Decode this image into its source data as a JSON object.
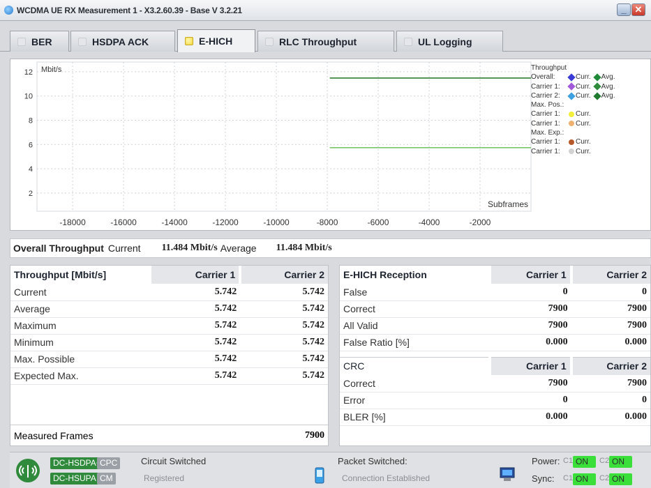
{
  "window": {
    "title": "WCDMA UE RX Measurement 1 - X3.2.60.39 - Base V 3.2.21",
    "minimize_glyph": "_",
    "close_glyph": "✕"
  },
  "tabs": [
    {
      "label": "BER",
      "active": false
    },
    {
      "label": "HSDPA ACK",
      "active": false
    },
    {
      "label": "E-HICH",
      "active": true
    },
    {
      "label": "RLC Throughput",
      "active": false
    },
    {
      "label": "UL Logging",
      "active": false
    }
  ],
  "chart": {
    "unit_label": "Mbit/s",
    "x_axis_label": "Subframes",
    "x_tick_labels": [
      "-18000",
      "-16000",
      "-14000",
      "-12000",
      "-10000",
      "-8000",
      "-6000",
      "-4000",
      "-2000"
    ],
    "y_tick_labels": [
      "12",
      "10",
      "8",
      "6",
      "4",
      "2"
    ],
    "legend": {
      "title": "Throughput",
      "rows": [
        {
          "label": "Overall:",
          "items": [
            {
              "text": "Curr.",
              "color": "#3a3ad6",
              "shape": "diamond"
            },
            {
              "text": "Avg.",
              "color": "#1f8a3a",
              "shape": "diamond"
            }
          ]
        },
        {
          "label": "Carrier 1:",
          "items": [
            {
              "text": "Curr.",
              "color": "#a259d9",
              "shape": "diamond"
            },
            {
              "text": "Avg.",
              "color": "#2e8b3a",
              "shape": "diamond"
            }
          ]
        },
        {
          "label": "Carrier 2:",
          "items": [
            {
              "text": "Curr.",
              "color": "#3da0e0",
              "shape": "diamond"
            },
            {
              "text": "Avg.",
              "color": "#1f7a2f",
              "shape": "diamond"
            }
          ]
        },
        {
          "label": "Max. Pos.:",
          "items": []
        },
        {
          "label": "Carrier 1:",
          "items": [
            {
              "text": "Curr.",
              "color": "#f4ef3a",
              "shape": "round"
            }
          ]
        },
        {
          "label": "Carrier 1:",
          "items": [
            {
              "text": "Curr.",
              "color": "#f0b070",
              "shape": "round"
            }
          ]
        },
        {
          "label": "Max. Exp.:",
          "items": []
        },
        {
          "label": "Carrier 1:",
          "items": [
            {
              "text": "Curr.",
              "color": "#b5592a",
              "shape": "round"
            }
          ]
        },
        {
          "label": "Carrier 1:",
          "items": [
            {
              "text": "Curr.",
              "color": "#d2d2d2",
              "shape": "round"
            }
          ]
        }
      ]
    }
  },
  "chart_data": {
    "type": "line",
    "xlabel": "Subframes",
    "ylabel": "Mbit/s",
    "xlim": [
      -19400,
      0
    ],
    "ylim": [
      0.5,
      12.8
    ],
    "x_ticks": [
      -18000,
      -16000,
      -14000,
      -12000,
      -10000,
      -8000,
      -6000,
      -4000,
      -2000
    ],
    "y_ticks": [
      2,
      4,
      6,
      8,
      10,
      12
    ],
    "grid": true,
    "legend_position": "right",
    "series": [
      {
        "color": "#2e7d32",
        "x": [
          -7900,
          0
        ],
        "y": [
          11.484,
          11.484
        ]
      },
      {
        "color": "#7cc46a",
        "x": [
          -7900,
          0
        ],
        "y": [
          5.742,
          5.742
        ]
      }
    ]
  },
  "overall": {
    "label": "Overall Throughput",
    "current_label": "Current",
    "current_value": "11.484 Mbit/s",
    "average_label": "Average",
    "average_value": "11.484 Mbit/s"
  },
  "throughput_table": {
    "headers": [
      "Throughput [Mbit/s]",
      "Carrier 1",
      "Carrier 2"
    ],
    "rows": [
      [
        "Current",
        "5.742",
        "5.742"
      ],
      [
        "Average",
        "5.742",
        "5.742"
      ],
      [
        "Maximum",
        "5.742",
        "5.742"
      ],
      [
        "Minimum",
        "5.742",
        "5.742"
      ],
      [
        "Max. Possible",
        "5.742",
        "5.742"
      ],
      [
        "Expected Max.",
        "5.742",
        "5.742"
      ]
    ],
    "measured_frames_label": "Measured Frames",
    "measured_frames_value": "7900"
  },
  "ehich_table": {
    "headers": [
      "E-HICH Reception",
      "Carrier 1",
      "Carrier 2"
    ],
    "rows": [
      [
        "False",
        "0",
        "0"
      ],
      [
        "Correct",
        "7900",
        "7900"
      ],
      [
        "All Valid",
        "7900",
        "7900"
      ],
      [
        "False Ratio [%]",
        "0.000",
        "0.000"
      ]
    ]
  },
  "crc_table": {
    "headers": [
      "CRC",
      "Carrier 1",
      "Carrier 2"
    ],
    "rows": [
      [
        "Correct",
        "7900",
        "7900"
      ],
      [
        "Error",
        "0",
        "0"
      ],
      [
        "BLER [%]",
        "0.000",
        "0.000"
      ]
    ]
  },
  "status": {
    "chip_dc_hsdpa": "DC-HSDPA+",
    "chip_cpc": "CPC",
    "chip_dc_hsupa": "DC-HSUPA",
    "chip_cm": "CM",
    "circuit_label": "Circuit Switched",
    "circuit_state": "Registered",
    "packet_label": "Packet Switched:",
    "packet_state": "Connection Established",
    "power_label": "Power:",
    "sync_label": "Sync:",
    "c1": "C1",
    "c2": "C2",
    "ok": "ON"
  }
}
